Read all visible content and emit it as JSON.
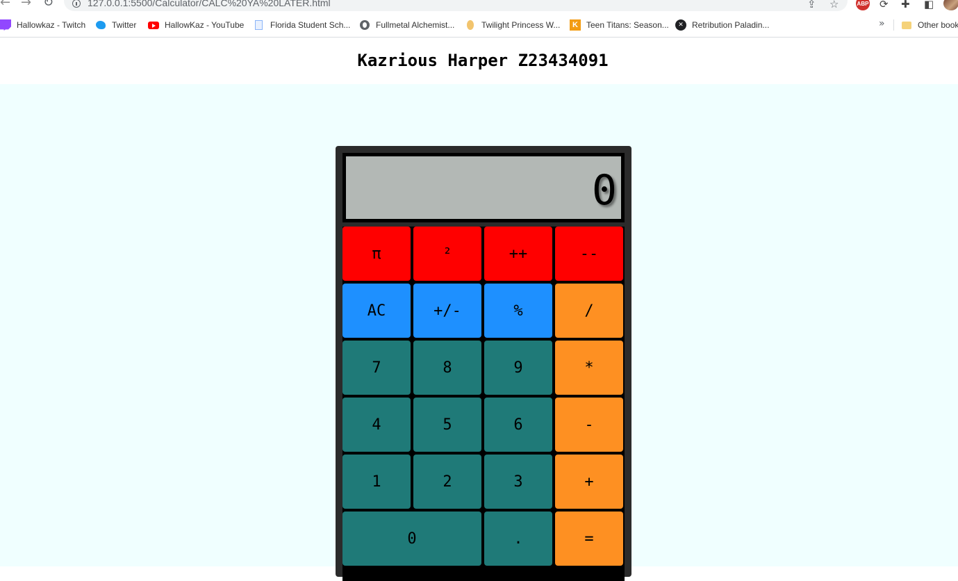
{
  "browser": {
    "url": "127.0.0.1:5500/Calculator/CALC%20YA%20LATER.html"
  },
  "bookmarks": {
    "items": [
      {
        "label": "Hallowkaz - Twitch",
        "icon": "twitch-icon"
      },
      {
        "label": "Twitter",
        "icon": "twitter-icon"
      },
      {
        "label": "HallowKaz - YouTube",
        "icon": "youtube-icon"
      },
      {
        "label": "Florida Student Sch...",
        "icon": "document-icon"
      },
      {
        "label": "Fullmetal Alchemist...",
        "icon": "globe-icon"
      },
      {
        "label": "Twilight Princess W...",
        "icon": "moon-icon"
      },
      {
        "label": "Teen Titans: Season...",
        "icon": "k-icon"
      },
      {
        "label": "Retribution Paladin...",
        "icon": "x-circle-icon"
      }
    ],
    "more": "»",
    "other": "Other book"
  },
  "page": {
    "title": "Kazrious Harper Z23434091"
  },
  "calculator": {
    "display": "0",
    "colors": {
      "body": "#2b2b2b",
      "display": "#b3b8b5",
      "function": "#ff0000",
      "utility": "#1e90ff",
      "digit": "#1f7a78",
      "operator": "#fe9022"
    },
    "keys": {
      "pi": "π",
      "square": "²",
      "increment": "++",
      "decrement": "--",
      "clear": "AC",
      "negate": "+/-",
      "percent": "%",
      "divide": "/",
      "seven": "7",
      "eight": "8",
      "nine": "9",
      "multiply": "*",
      "four": "4",
      "five": "5",
      "six": "6",
      "subtract": "-",
      "one": "1",
      "two": "2",
      "three": "3",
      "add": "+",
      "zero": "0",
      "decimal": ".",
      "equals": "="
    }
  }
}
